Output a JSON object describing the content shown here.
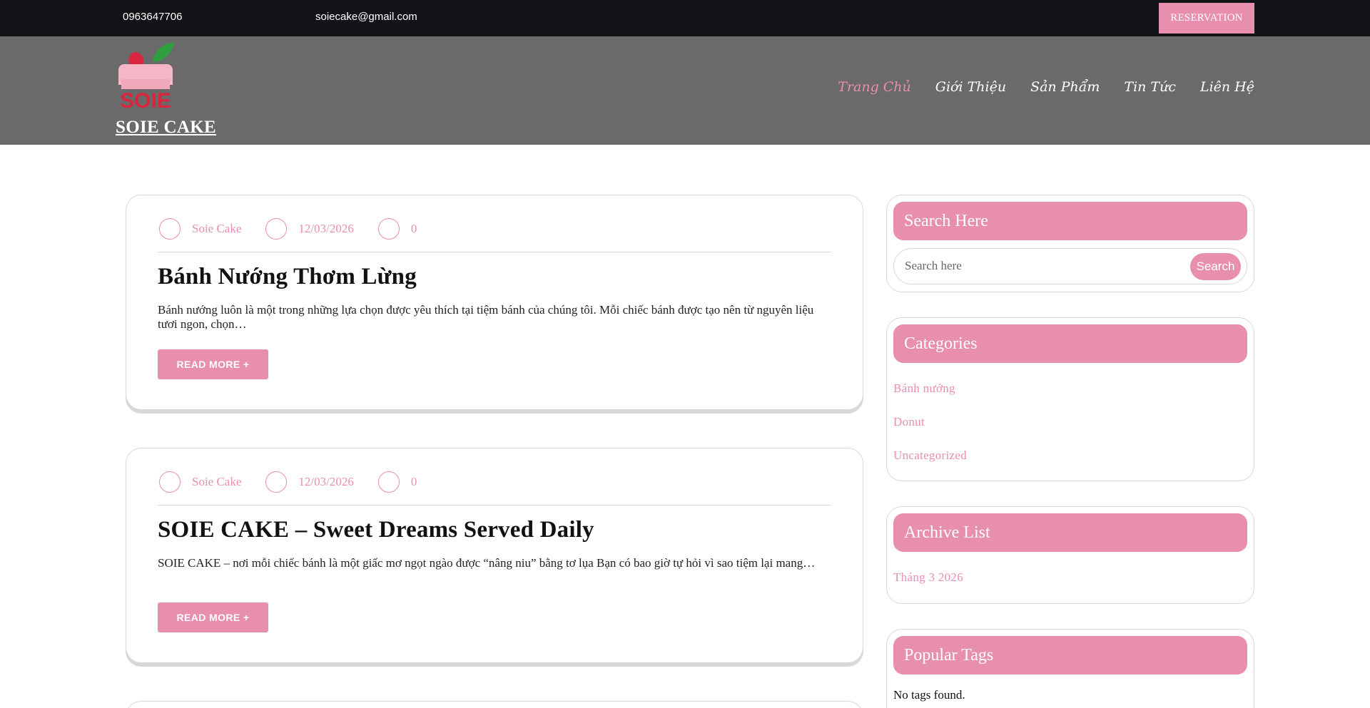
{
  "topbar": {
    "phone": "0963647706",
    "email": "soiecake@gmail.com",
    "reservation_label": "RESERVATION"
  },
  "header": {
    "logo_text": "SOIE",
    "site_title": "SOIE CAKE",
    "nav": [
      {
        "label": "Trang Chủ",
        "active": true
      },
      {
        "label": "Giới Thiệu",
        "active": false
      },
      {
        "label": "Sản Phẩm",
        "active": false
      },
      {
        "label": "Tin Tức",
        "active": false
      },
      {
        "label": "Liên Hệ",
        "active": false
      }
    ]
  },
  "posts": [
    {
      "author": "Soie Cake",
      "date": "12/03/2026",
      "comments": "0",
      "title": " Bánh Nướng Thơm Lừng",
      "excerpt": "Bánh nướng luôn là một trong những lựa chọn được yêu thích tại tiệm bánh của chúng tôi. Mỗi chiếc bánh được tạo nên từ nguyên liệu tươi ngon, chọn…",
      "read_more": "READ MORE +"
    },
    {
      "author": "Soie Cake",
      "date": "12/03/2026",
      "comments": "0",
      "title": "SOIE CAKE – Sweet Dreams Served Daily",
      "excerpt": "SOIE CAKE – nơi mỗi chiếc bánh là một giấc mơ ngọt ngào được “nâng niu” bằng tơ lụa Bạn có bao giờ tự hỏi vì sao tiệm lại mang…",
      "read_more": "READ MORE +"
    }
  ],
  "sidebar": {
    "search": {
      "heading": "Search Here",
      "placeholder": "Search here",
      "button": "Search"
    },
    "categories": {
      "heading": "Categories",
      "items": [
        "Bánh nướng",
        "Donut",
        "Uncategorized"
      ]
    },
    "archive": {
      "heading": "Archive List",
      "items": [
        "Tháng 3 2026"
      ]
    },
    "tags": {
      "heading": "Popular Tags",
      "empty_text": "No tags found."
    }
  },
  "colors": {
    "accent": "#e88eaf",
    "topbar_bg": "#121317",
    "header_bg": "#6a6a6a"
  }
}
